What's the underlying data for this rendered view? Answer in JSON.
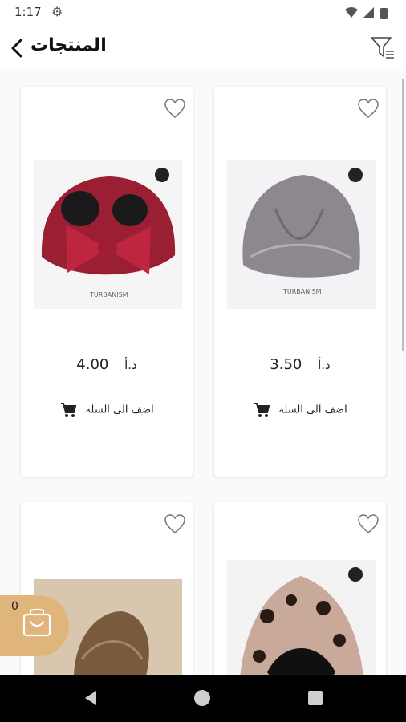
{
  "status_bar": {
    "time": "1:17"
  },
  "header": {
    "title": "المنتجات"
  },
  "products": [
    {
      "price": "3.50",
      "currency": "د.أ",
      "add_label": "اضف الى السلة",
      "image": "grey-glitter-turban",
      "colors": {
        "main": "#8d8790"
      }
    },
    {
      "price": "4.00",
      "currency": "د.أ",
      "add_label": "اضف الى السلة",
      "image": "red-bow-turban",
      "colors": {
        "main": "#9a1f33"
      }
    },
    {
      "image": "leopard-print-turban",
      "colors": {
        "main": "#c9a99a"
      }
    },
    {
      "image": "bronze-turban",
      "colors": {
        "main": "#7a5a3c"
      }
    }
  ],
  "floating_cart": {
    "count": "0"
  },
  "colors": {
    "accent": "#e0b57c",
    "nav": "#000000"
  }
}
